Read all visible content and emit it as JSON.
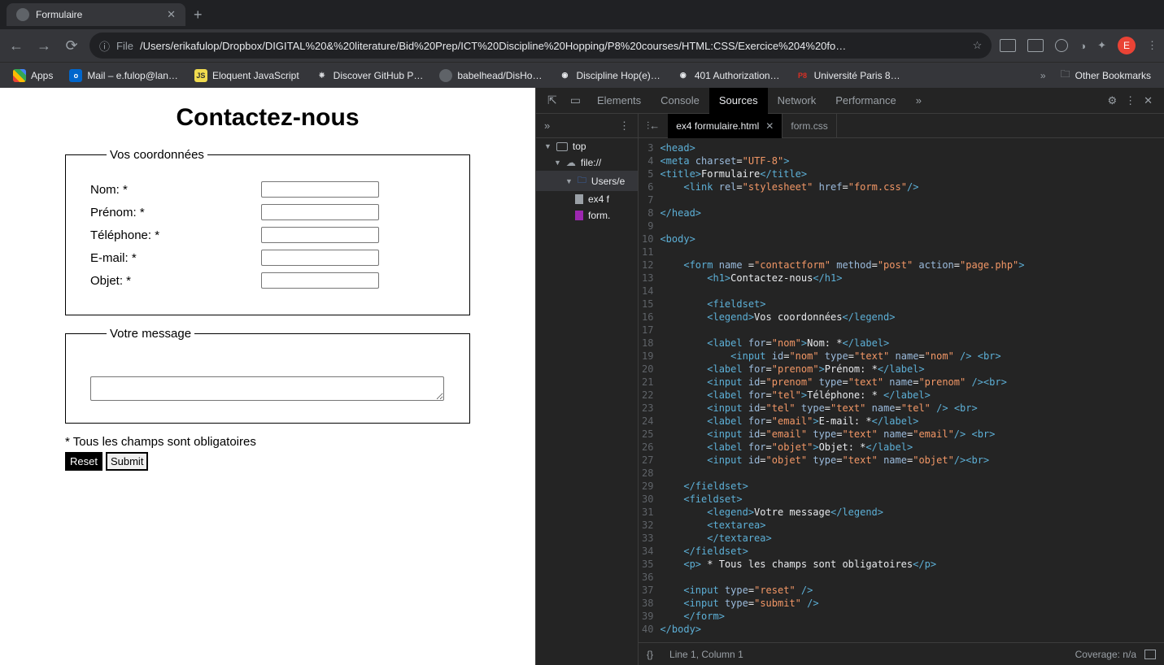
{
  "browser": {
    "tab_title": "Formulaire",
    "url_scheme": "File",
    "url_path": "/Users/erikafulop/Dropbox/DIGITAL%20&%20literature/Bid%20Prep/ICT%20Discipline%20Hopping/P8%20courses/HTML:CSS/Exercice%204%20fo…",
    "avatar_letter": "E",
    "bookmarks": {
      "apps": "Apps",
      "mail": "Mail – e.fulop@lan…",
      "eloquent": "Eloquent JavaScript",
      "github": "Discover GitHub P…",
      "babel": "babelhead/DisHo…",
      "disc": "Discipline Hop(e)…",
      "auth": "401 Authorization…",
      "paris": "Université Paris 8…",
      "other": "Other Bookmarks"
    }
  },
  "form_page": {
    "heading": "Contactez-nous",
    "legend1": "Vos coordonnées",
    "legend2": "Votre message",
    "labels": {
      "nom": "Nom: *",
      "prenom": "Prénom: *",
      "tel": "Téléphone: *",
      "email": "E-mail: *",
      "objet": "Objet: *"
    },
    "oblig": "* Tous les champs sont obligatoires",
    "reset": "Reset",
    "submit": "Submit"
  },
  "devtools": {
    "tabs": {
      "elements": "Elements",
      "console": "Console",
      "sources": "Sources",
      "network": "Network",
      "performance": "Performance"
    },
    "tree": {
      "top": "top",
      "file": "file://",
      "users": "Users/e",
      "ex4": "ex4 f",
      "formcss": "form.",
      "ex4_full": "ex4 formulaire.html",
      "formcss_full": "form.css"
    },
    "status": {
      "cursor": "Line 1, Column 1",
      "coverage": "Coverage: n/a"
    },
    "code_lines": [
      {
        "n": 3,
        "h": "<span class='c-tag'>&lt;head&gt;</span>"
      },
      {
        "n": 4,
        "h": "<span class='c-tag'>&lt;meta</span> <span class='c-attr'>charset</span>=<span class='c-str'>\"UTF-8\"</span><span class='c-tag'>&gt;</span>"
      },
      {
        "n": 5,
        "h": "<span class='c-tag'>&lt;title&gt;</span><span class='c-txt'>Formulaire</span><span class='c-tag'>&lt;/title&gt;</span>"
      },
      {
        "n": 6,
        "h": "    <span class='c-tag'>&lt;link</span> <span class='c-attr'>rel</span>=<span class='c-str'>\"stylesheet\"</span> <span class='c-attr'>href</span>=<span class='c-str'>\"form.css\"</span><span class='c-tag'>/&gt;</span>"
      },
      {
        "n": 7,
        "h": ""
      },
      {
        "n": 8,
        "h": "<span class='c-tag'>&lt;/head&gt;</span>"
      },
      {
        "n": 9,
        "h": ""
      },
      {
        "n": 10,
        "h": "<span class='c-tag'>&lt;body&gt;</span>"
      },
      {
        "n": 11,
        "h": ""
      },
      {
        "n": 12,
        "h": "    <span class='c-tag'>&lt;form</span> <span class='c-attr'>name </span>=<span class='c-str'>\"contactform\"</span> <span class='c-attr'>method</span>=<span class='c-str'>\"post\"</span> <span class='c-attr'>action</span>=<span class='c-str'>\"page.php\"</span><span class='c-tag'>&gt;</span>"
      },
      {
        "n": 13,
        "h": "        <span class='c-tag'>&lt;h1&gt;</span><span class='c-txt'>Contactez-nous</span><span class='c-tag'>&lt;/h1&gt;</span>"
      },
      {
        "n": 14,
        "h": ""
      },
      {
        "n": 15,
        "h": "        <span class='c-tag'>&lt;fieldset&gt;</span>"
      },
      {
        "n": 16,
        "h": "        <span class='c-tag'>&lt;legend&gt;</span><span class='c-txt'>Vos coordonnées</span><span class='c-tag'>&lt;/legend&gt;</span>"
      },
      {
        "n": 17,
        "h": ""
      },
      {
        "n": 18,
        "h": "        <span class='c-tag'>&lt;label</span> <span class='c-attr'>for</span>=<span class='c-str'>\"nom\"</span><span class='c-tag'>&gt;</span><span class='c-txt'>Nom: *</span><span class='c-tag'>&lt;/label&gt;</span>"
      },
      {
        "n": 19,
        "h": "            <span class='c-tag'>&lt;input</span> <span class='c-attr'>id</span>=<span class='c-str'>\"nom\"</span> <span class='c-attr'>type</span>=<span class='c-str'>\"text\"</span> <span class='c-attr'>name</span>=<span class='c-str'>\"nom\"</span><span class='c-tag'> /&gt;</span> <span class='c-tag'>&lt;br&gt;</span>"
      },
      {
        "n": 20,
        "h": "        <span class='c-tag'>&lt;label</span> <span class='c-attr'>for</span>=<span class='c-str'>\"prenom\"</span><span class='c-tag'>&gt;</span><span class='c-txt'>Prénom: *</span><span class='c-tag'>&lt;/label&gt;</span>"
      },
      {
        "n": 21,
        "h": "        <span class='c-tag'>&lt;input</span> <span class='c-attr'>id</span>=<span class='c-str'>\"prenom\"</span> <span class='c-attr'>type</span>=<span class='c-str'>\"text\"</span> <span class='c-attr'>name</span>=<span class='c-str'>\"prenom\"</span><span class='c-tag'> /&gt;&lt;br&gt;</span>"
      },
      {
        "n": 22,
        "h": "        <span class='c-tag'>&lt;label</span> <span class='c-attr'>for</span>=<span class='c-str'>\"tel\"</span><span class='c-tag'>&gt;</span><span class='c-txt'>Téléphone: * </span><span class='c-tag'>&lt;/label&gt;</span>"
      },
      {
        "n": 23,
        "h": "        <span class='c-tag'>&lt;input</span> <span class='c-attr'>id</span>=<span class='c-str'>\"tel\"</span> <span class='c-attr'>type</span>=<span class='c-str'>\"text\"</span> <span class='c-attr'>name</span>=<span class='c-str'>\"tel\"</span><span class='c-tag'> /&gt;</span> <span class='c-tag'>&lt;br&gt;</span>"
      },
      {
        "n": 24,
        "h": "        <span class='c-tag'>&lt;label</span> <span class='c-attr'>for</span>=<span class='c-str'>\"email\"</span><span class='c-tag'>&gt;</span><span class='c-txt'>E-mail: *</span><span class='c-tag'>&lt;/label&gt;</span>"
      },
      {
        "n": 25,
        "h": "        <span class='c-tag'>&lt;input</span> <span class='c-attr'>id</span>=<span class='c-str'>\"email\"</span> <span class='c-attr'>type</span>=<span class='c-str'>\"text\"</span> <span class='c-attr'>name</span>=<span class='c-str'>\"email\"</span><span class='c-tag'>/&gt;</span> <span class='c-tag'>&lt;br&gt;</span>"
      },
      {
        "n": 26,
        "h": "        <span class='c-tag'>&lt;label</span> <span class='c-attr'>for</span>=<span class='c-str'>\"objet\"</span><span class='c-tag'>&gt;</span><span class='c-txt'>Objet: *</span><span class='c-tag'>&lt;/label&gt;</span>"
      },
      {
        "n": 27,
        "h": "        <span class='c-tag'>&lt;input</span> <span class='c-attr'>id</span>=<span class='c-str'>\"objet\"</span> <span class='c-attr'>type</span>=<span class='c-str'>\"text\"</span> <span class='c-attr'>name</span>=<span class='c-str'>\"objet\"</span><span class='c-tag'>/&gt;&lt;br&gt;</span>"
      },
      {
        "n": 28,
        "h": ""
      },
      {
        "n": 29,
        "h": "    <span class='c-tag'>&lt;/fieldset&gt;</span>"
      },
      {
        "n": 30,
        "h": "    <span class='c-tag'>&lt;fieldset&gt;</span>"
      },
      {
        "n": 31,
        "h": "        <span class='c-tag'>&lt;legend&gt;</span><span class='c-txt'>Votre message</span><span class='c-tag'>&lt;/legend&gt;</span>"
      },
      {
        "n": 32,
        "h": "        <span class='c-tag'>&lt;textarea&gt;</span>"
      },
      {
        "n": 33,
        "h": "        <span class='c-tag'>&lt;/textarea&gt;</span>"
      },
      {
        "n": 34,
        "h": "    <span class='c-tag'>&lt;/fieldset&gt;</span>"
      },
      {
        "n": 35,
        "h": "    <span class='c-tag'>&lt;p&gt;</span><span class='c-txt'> * Tous les champs sont obligatoires</span><span class='c-tag'>&lt;/p&gt;</span>"
      },
      {
        "n": 36,
        "h": ""
      },
      {
        "n": 37,
        "h": "    <span class='c-tag'>&lt;input</span> <span class='c-attr'>type</span>=<span class='c-str'>\"reset\"</span><span class='c-tag'> /&gt;</span>"
      },
      {
        "n": 38,
        "h": "    <span class='c-tag'>&lt;input</span> <span class='c-attr'>type</span>=<span class='c-str'>\"submit\"</span><span class='c-tag'> /&gt;</span>"
      },
      {
        "n": 39,
        "h": "    <span class='c-tag'>&lt;/form&gt;</span>"
      },
      {
        "n": 40,
        "h": "<span class='c-tag'>&lt;/body&gt;</span>"
      }
    ]
  }
}
